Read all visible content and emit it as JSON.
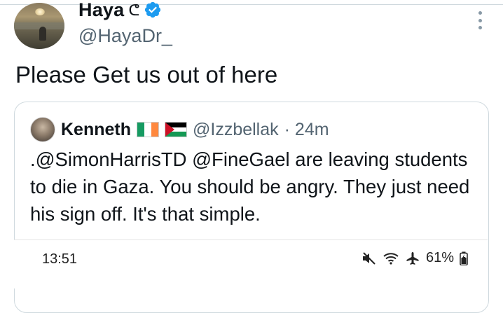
{
  "tweet": {
    "author_name": "Haya",
    "author_glyph": "ᕦ",
    "handle": "@HayaDr_",
    "text": "Please Get us out of here"
  },
  "quoted": {
    "name": "Kenneth",
    "handle": "@Izzbellak",
    "time": "· 24m",
    "text": ".@SimonHarrisTD @FineGael are leaving students to die in Gaza. You should be angry. They just need his sign off. It's that simple.",
    "flags": [
      "ireland-flag",
      "palestine-flag"
    ]
  },
  "status_bar": {
    "time": "13:51",
    "battery": "61%",
    "icons": [
      "mute-icon",
      "wifi-icon",
      "airplane-icon",
      "battery-icon"
    ]
  },
  "colors": {
    "verified_blue": "#1d9bf0",
    "handle_gray": "#536471",
    "border": "#cfd9de"
  }
}
